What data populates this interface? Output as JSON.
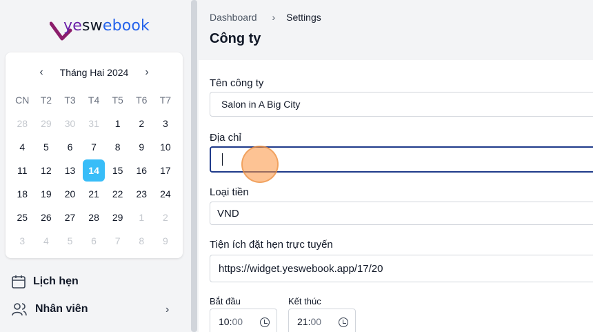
{
  "brand": {
    "logo_text_1": "ye",
    "logo_text_2": "sw",
    "logo_text_3": "ebook"
  },
  "calendar": {
    "month_label": "Tháng Hai 2024",
    "prev_icon": "‹",
    "next_icon": "›",
    "weekdays": [
      "CN",
      "T2",
      "T3",
      "T4",
      "T5",
      "T6",
      "T7"
    ],
    "days": [
      {
        "d": "28",
        "m": true
      },
      {
        "d": "29",
        "m": true
      },
      {
        "d": "30",
        "m": true
      },
      {
        "d": "31",
        "m": true
      },
      {
        "d": "1"
      },
      {
        "d": "2"
      },
      {
        "d": "3"
      },
      {
        "d": "4"
      },
      {
        "d": "5"
      },
      {
        "d": "6"
      },
      {
        "d": "7"
      },
      {
        "d": "8"
      },
      {
        "d": "9"
      },
      {
        "d": "10"
      },
      {
        "d": "11"
      },
      {
        "d": "12"
      },
      {
        "d": "13"
      },
      {
        "d": "14",
        "t": true
      },
      {
        "d": "15"
      },
      {
        "d": "16"
      },
      {
        "d": "17"
      },
      {
        "d": "18"
      },
      {
        "d": "19"
      },
      {
        "d": "20"
      },
      {
        "d": "21"
      },
      {
        "d": "22"
      },
      {
        "d": "23"
      },
      {
        "d": "24"
      },
      {
        "d": "25"
      },
      {
        "d": "26"
      },
      {
        "d": "27"
      },
      {
        "d": "28"
      },
      {
        "d": "29"
      },
      {
        "d": "1",
        "m": true
      },
      {
        "d": "2",
        "m": true
      },
      {
        "d": "3",
        "m": true
      },
      {
        "d": "4",
        "m": true
      },
      {
        "d": "5",
        "m": true
      },
      {
        "d": "6",
        "m": true
      },
      {
        "d": "7",
        "m": true
      },
      {
        "d": "8",
        "m": true
      },
      {
        "d": "9",
        "m": true
      }
    ],
    "today_color": "#38bdf8"
  },
  "nav": {
    "appointments": "Lịch hẹn",
    "staff": "Nhân viên",
    "chevron": "›"
  },
  "breadcrumb": {
    "home": "Dashboard",
    "sep": "›",
    "current": "Settings"
  },
  "page": {
    "title": "Công ty"
  },
  "form": {
    "company_label": "Tên công ty",
    "company_value": "Salon in A Big City",
    "address_label": "Địa chỉ",
    "address_value": "",
    "currency_label": "Loại tiền",
    "currency_value": "VND",
    "widget_label": "Tiện ích đặt hẹn trực tuyến",
    "widget_value": "https://widget.yeswebook.app/17/20",
    "start_label": "Bắt đầu",
    "start_hh": "10:",
    "start_mm": "00",
    "end_label": "Kết thúc",
    "end_hh": "21:",
    "end_mm": "00"
  }
}
